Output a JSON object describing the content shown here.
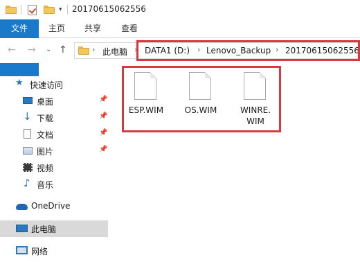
{
  "window": {
    "title": "20170615062556"
  },
  "ribbon": {
    "tabs": [
      "文件",
      "主页",
      "共享",
      "查看"
    ]
  },
  "address": {
    "crumbs": [
      "此电脑",
      "DATA1 (D:)",
      "Lenovo_Backup",
      "20170615062556"
    ]
  },
  "sidebar": {
    "items": [
      {
        "label": "快速访问",
        "icon": "star-icon"
      },
      {
        "label": "桌面",
        "icon": "desktop-icon",
        "pinned": true
      },
      {
        "label": "下载",
        "icon": "download-icon",
        "pinned": true
      },
      {
        "label": "文档",
        "icon": "document-icon",
        "pinned": true
      },
      {
        "label": "图片",
        "icon": "picture-icon",
        "pinned": true
      },
      {
        "label": "视频",
        "icon": "video-icon"
      },
      {
        "label": "音乐",
        "icon": "music-icon"
      },
      {
        "label": "OneDrive",
        "icon": "cloud-icon"
      },
      {
        "label": "此电脑",
        "icon": "computer-icon",
        "selected": true
      },
      {
        "label": "网络",
        "icon": "network-icon"
      }
    ]
  },
  "files": [
    {
      "name": "ESP.WIM"
    },
    {
      "name": "OS.WIM"
    },
    {
      "name": "WINRE.WIM"
    }
  ],
  "colors": {
    "accent": "#1979ca",
    "highlight": "#d8383f",
    "selected": "#d9d9d9"
  }
}
